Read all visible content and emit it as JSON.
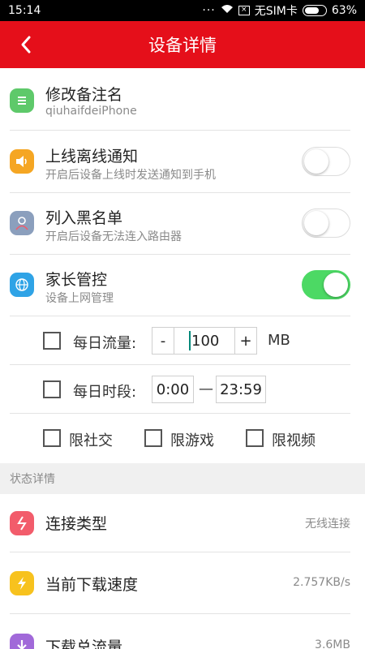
{
  "status_bar": {
    "time": "15:14",
    "carrier": "无SIM卡",
    "battery": "63%"
  },
  "header": {
    "title": "设备详情",
    "back_icon": "chevron-left-icon"
  },
  "rows": {
    "rename": {
      "label": "修改备注名",
      "sub": "qiuhaifdeiPhone",
      "icon_color": "#5ec96a"
    },
    "online_notify": {
      "label": "上线离线通知",
      "sub": "开启后设备上线时发送通知到手机",
      "icon_color": "#f5a623",
      "toggle": "off"
    },
    "blacklist": {
      "label": "列入黑名单",
      "sub": "开启后设备无法连入路由器",
      "icon_color": "#8b9fbd",
      "toggle": "off"
    },
    "parental": {
      "label": "家长管控",
      "sub": "设备上网管理",
      "icon_color": "#2fa3e6",
      "toggle": "on"
    }
  },
  "parental_controls": {
    "daily_traffic": {
      "label": "每日流量:",
      "minus": "-",
      "value": "100",
      "plus": "+",
      "unit": "MB"
    },
    "daily_time": {
      "label": "每日时段:",
      "start": "0:00",
      "dash": "—",
      "end": "23:59"
    },
    "limits": [
      "限社交",
      "限游戏",
      "限视频"
    ]
  },
  "status_section": {
    "title": "状态详情",
    "items": [
      {
        "label": "连接类型",
        "value": "无线连接",
        "icon_color": "#f25c6b"
      },
      {
        "label": "当前下载速度",
        "value": "2.757KB/s",
        "icon_color": "#f7c21e"
      },
      {
        "label": "下载总流量",
        "value": "3.6MB",
        "icon_color": "#a169d9"
      }
    ]
  },
  "colors": {
    "brand_red": "#e50f1a",
    "toggle_on": "#4cd964"
  }
}
